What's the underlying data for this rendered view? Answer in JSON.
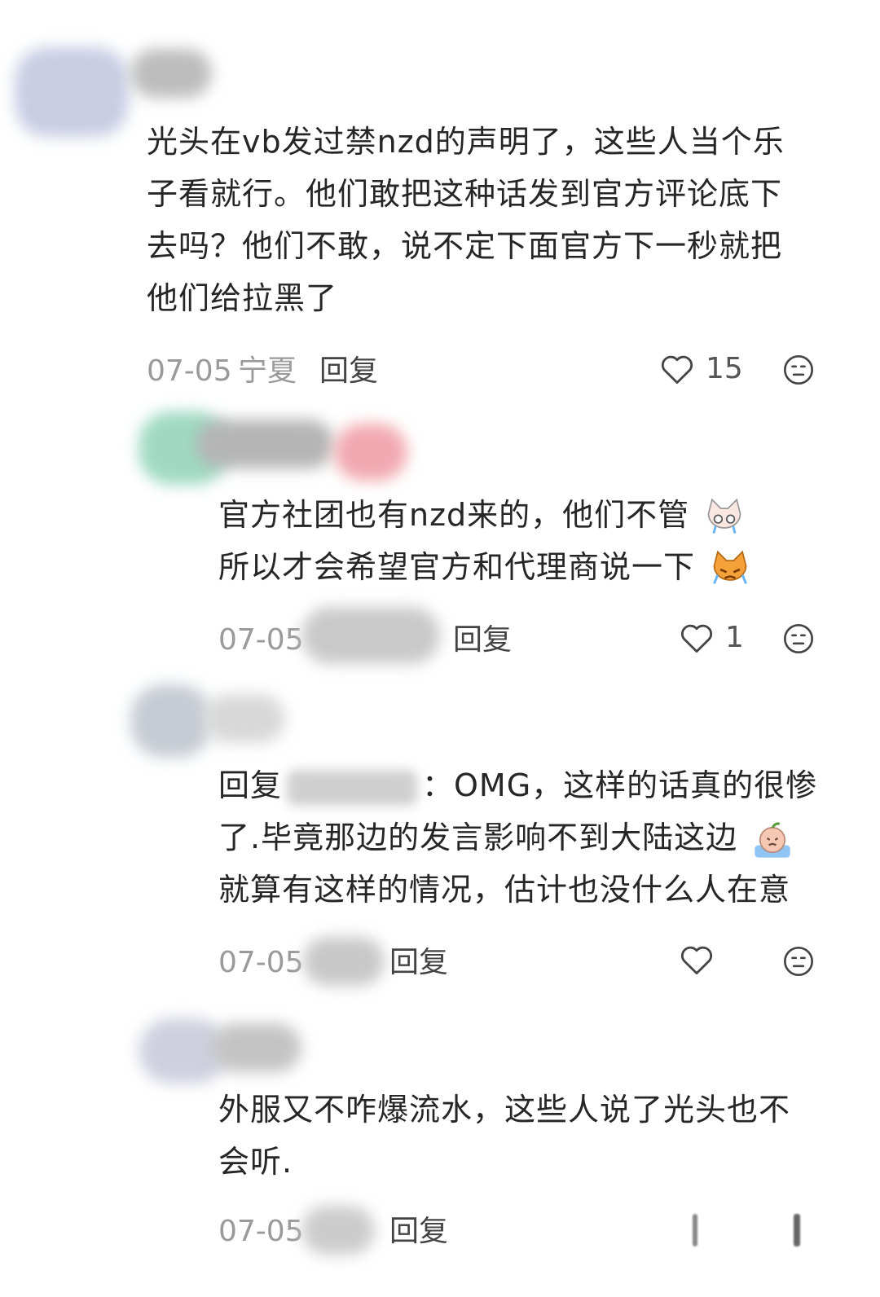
{
  "comments": [
    {
      "text": [
        "光头在vb发过禁nzd的声明了，这些人当个乐",
        "子看就行。他们敢把这种话发到官方评论底下",
        "去吗？他们不敢，说不定下面官方下一秒就把",
        "他们给拉黑了"
      ],
      "date": "07-05",
      "location": "宁夏",
      "reply_label": "回复",
      "likes": "15"
    },
    {
      "text": [
        "官方社团也有nzd来的，他们不管",
        "所以才会希望官方和代理商说一下"
      ],
      "date": "07-05",
      "reply_label": "回复",
      "likes": "1",
      "emojis": [
        "crying-cat-emoji",
        "angry-cat-emoji"
      ]
    },
    {
      "reply_prefix": "回复",
      "text_line1_suffix": "：OMG，这样的话真的很惨",
      "text": [
        "了.毕竟那边的发言影响不到大陆这边",
        "就算有这样的情况，估计也没什么人在意"
      ],
      "date": "07-05",
      "reply_label": "回复",
      "emojis": [
        "crying-peach-emoji"
      ]
    },
    {
      "text": [
        "外服又不咋爆流水，这些人说了光头也不",
        "会听."
      ],
      "date": "07-05",
      "reply_label": "回复"
    }
  ],
  "colors": {
    "background": "#ffffff",
    "text": "#262626",
    "meta": "#9a9a9a"
  }
}
